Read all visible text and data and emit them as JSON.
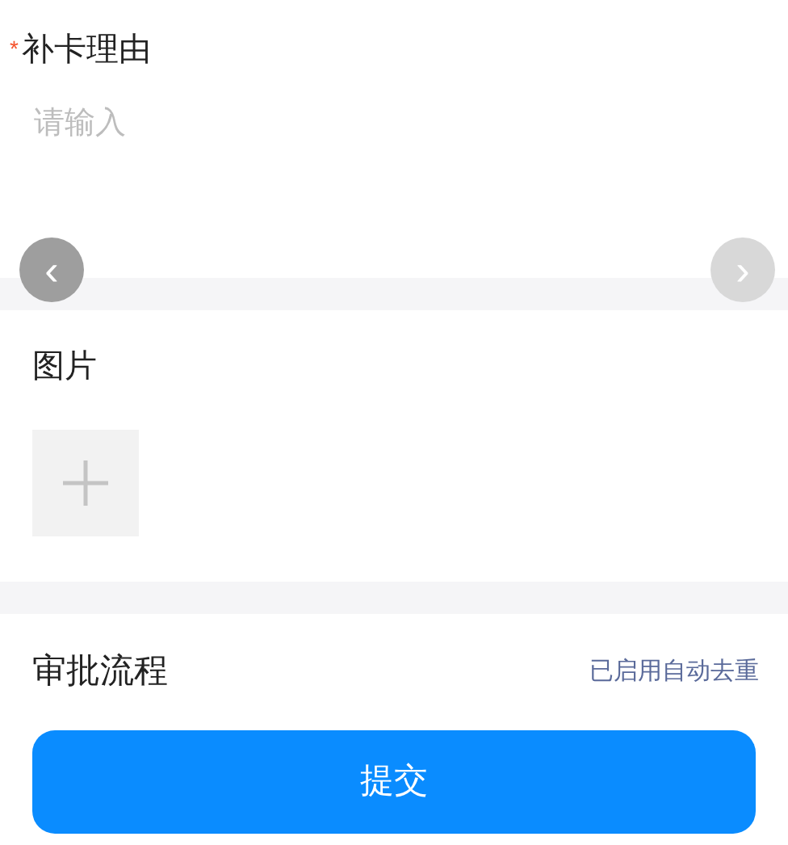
{
  "reason": {
    "required_mark": "*",
    "label": "补卡理由",
    "placeholder": "请输入"
  },
  "nav": {
    "prev": "‹",
    "next": "›"
  },
  "images": {
    "label": "图片"
  },
  "approval": {
    "label": "审批流程",
    "note": "已启用自动去重"
  },
  "submit": "提交"
}
